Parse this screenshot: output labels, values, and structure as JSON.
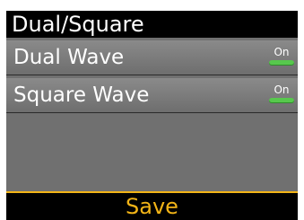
{
  "header": {
    "title": "Dual/Square"
  },
  "options": [
    {
      "label": "Dual Wave",
      "state": "On"
    },
    {
      "label": "Square Wave",
      "state": "On"
    }
  ],
  "footer": {
    "save_label": "Save"
  },
  "colors": {
    "toggle_on": "#57c84d",
    "accent": "#f2b417",
    "background": "#707070"
  },
  "icons": [
    "toggle-on-icon"
  ]
}
